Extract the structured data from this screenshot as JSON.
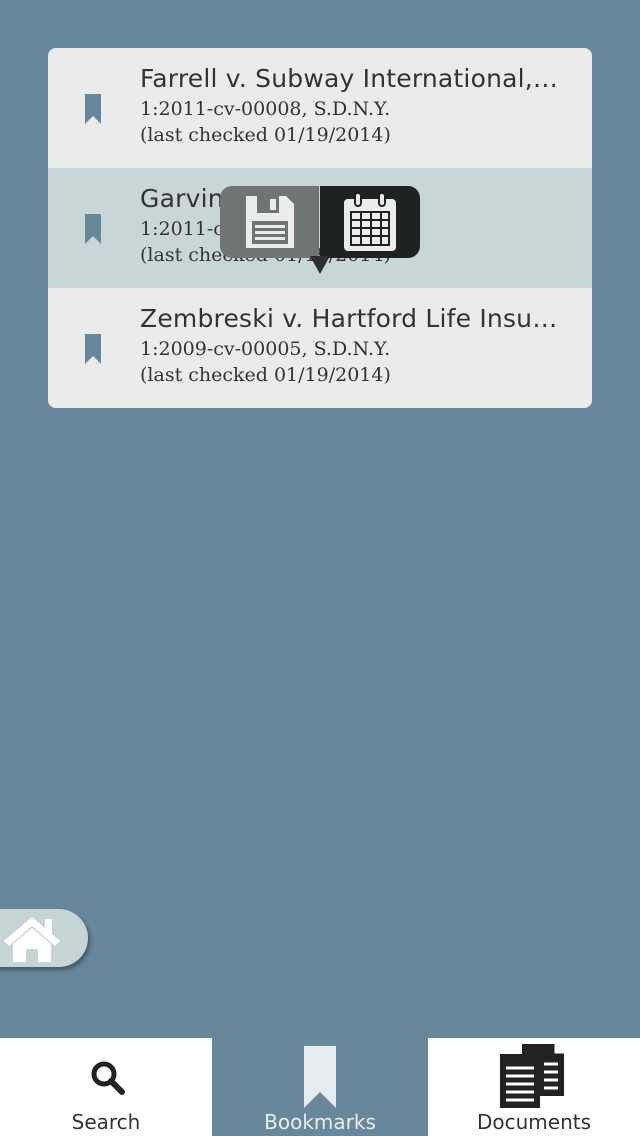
{
  "bookmarks": [
    {
      "title": "Farrell v. Subway International,…",
      "case": "1:2011-cv-00008, S.D.N.Y.",
      "checked": "(last checked 01/19/2014)"
    },
    {
      "title": "Garvin",
      "case": "1:2011-c",
      "checked": "(last checked 01/19/2014)"
    },
    {
      "title": "Zembreski v. Hartford Life Insura…",
      "case": "1:2009-cv-00005, S.D.N.Y.",
      "checked": "(last checked 01/19/2014)"
    }
  ],
  "popover": {
    "actions": [
      "save-icon",
      "calendar-icon"
    ]
  },
  "home_button": {
    "icon": "home-icon"
  },
  "tabs": [
    {
      "label": "Search",
      "icon": "search-icon"
    },
    {
      "label": "Bookmarks",
      "icon": "bookmark-icon"
    },
    {
      "label": "Documents",
      "icon": "documents-icon"
    }
  ],
  "colors": {
    "background": "#68879a",
    "row": "#ebebeb",
    "row_selected": "#c8d6d8",
    "bookmark_icon": "#68879a",
    "popover_light": "#6f7574",
    "popover_dark": "#1f2222"
  }
}
